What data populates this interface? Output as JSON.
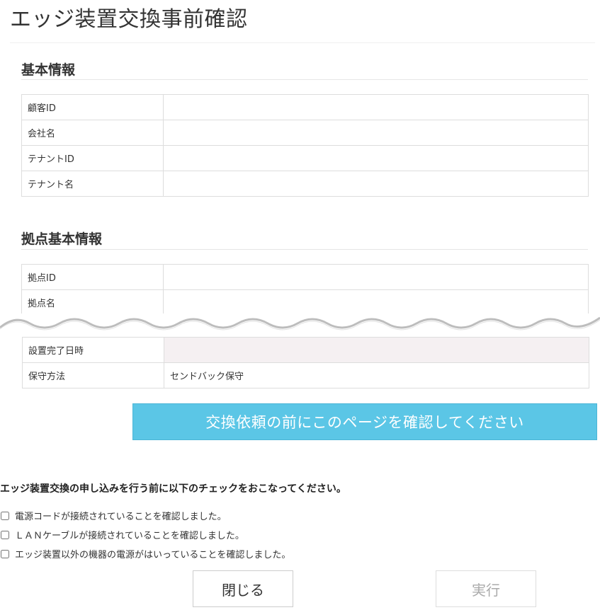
{
  "page": {
    "title": "エッジ装置交換事前確認"
  },
  "basic_info": {
    "heading": "基本情報",
    "rows": [
      {
        "label": "顧客ID",
        "value": ""
      },
      {
        "label": "会社名",
        "value": ""
      },
      {
        "label": "テナントID",
        "value": ""
      },
      {
        "label": "テナント名",
        "value": ""
      }
    ]
  },
  "site_info": {
    "heading": "拠点基本情報",
    "rows_top": [
      {
        "label": "拠点ID",
        "value": ""
      },
      {
        "label": "拠点名",
        "value": ""
      }
    ],
    "rows_bottom": [
      {
        "label": "設置完了日時",
        "value": ""
      },
      {
        "label": "保守方法",
        "value": "センドバック保守"
      }
    ]
  },
  "banner": {
    "text": "交換依頼の前にこのページを確認してください",
    "color": "#5bc6e6"
  },
  "checklist": {
    "instruction": "エッジ装置交換の申し込みを行う前に以下のチェックをおこなってください。",
    "items": [
      {
        "label": "電源コードが接続されていることを確認しました。",
        "checked": false
      },
      {
        "label": "ＬＡＮケーブルが接続されていることを確認しました。",
        "checked": false
      },
      {
        "label": "エッジ装置以外の機器の電源がはいっていることを確認しました。",
        "checked": false
      }
    ]
  },
  "buttons": {
    "close_label": "閉じる",
    "execute_label": "実行"
  }
}
